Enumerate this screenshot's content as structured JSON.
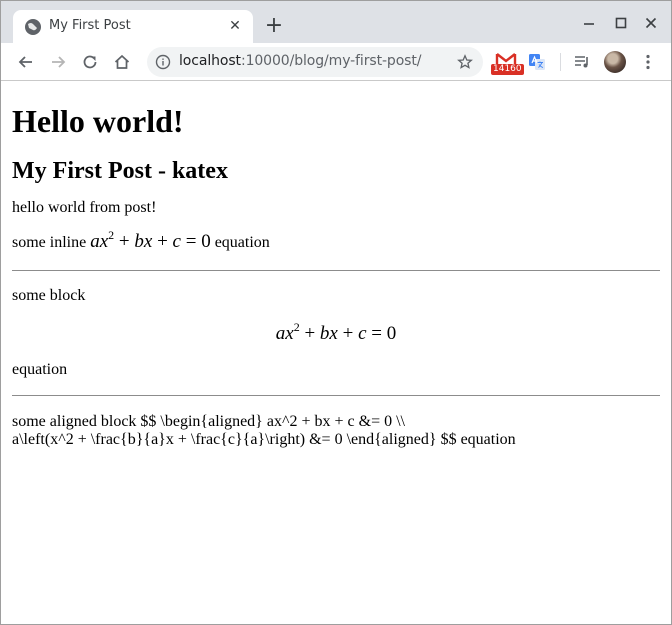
{
  "browser": {
    "tab_title": "My First Post",
    "tab_close_glyph": "✕",
    "new_tab_glyph": "+",
    "url_host": "localhost",
    "url_path": ":10000/blog/my-first-post/",
    "gmail_badge": "14160",
    "accent_color": "#d93025"
  },
  "page": {
    "heading": "Hello world!",
    "subheading": "My First Post - katex",
    "paragraph_1": "hello world from post!",
    "inline_prefix": "some inline",
    "inline_suffix": "equation",
    "block_label": "some block",
    "block_suffix": "equation",
    "aligned_line_1": "some aligned block $$ \\begin{aligned} ax^2 + bx + c &= 0 \\\\",
    "aligned_line_2": "a\\left(x^2 + \\frac{b}{a}x + \\frac{c}{a}\\right) &= 0 \\end{aligned} $$ equation"
  },
  "equation": {
    "a": "a",
    "x": "x",
    "exp": "2",
    "plus": "+",
    "b": "b",
    "c": "c",
    "eq": "=",
    "zero": "0"
  }
}
